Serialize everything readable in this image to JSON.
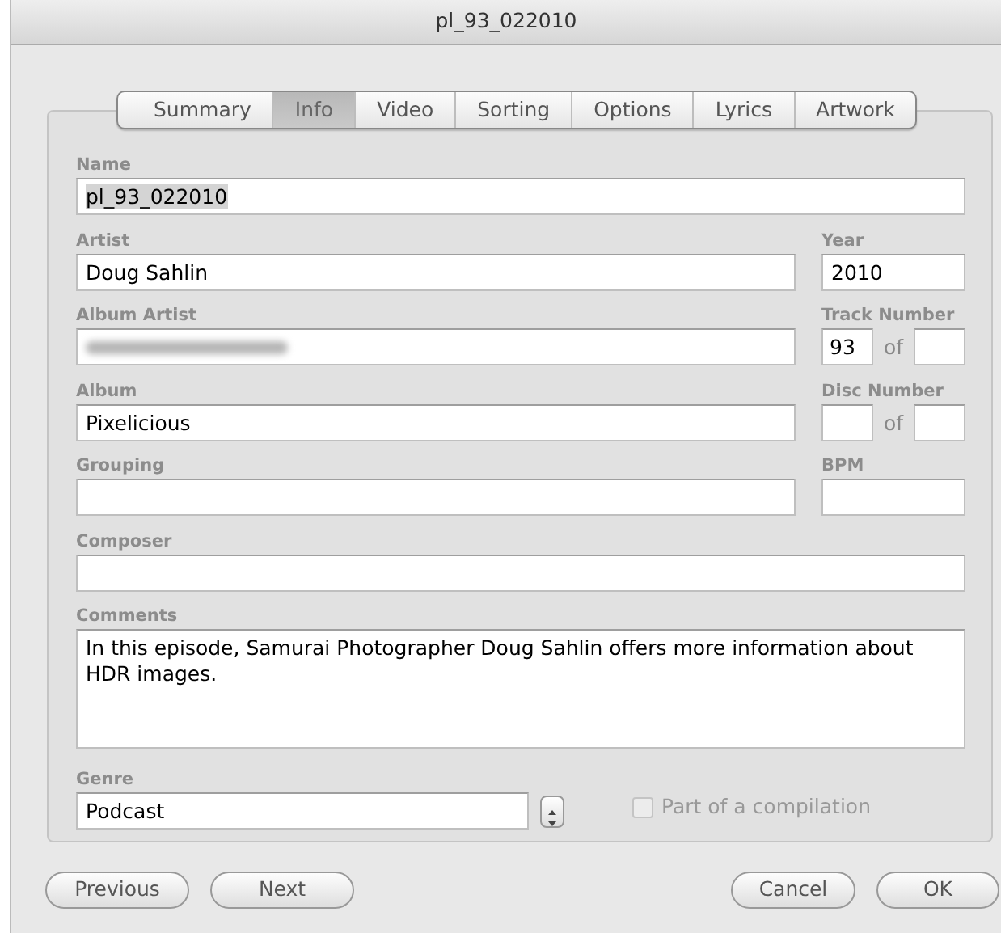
{
  "window": {
    "title": "pl_93_022010"
  },
  "tabs": [
    {
      "label": "Summary",
      "selected": false
    },
    {
      "label": "Info",
      "selected": true
    },
    {
      "label": "Video",
      "selected": false
    },
    {
      "label": "Sorting",
      "selected": false
    },
    {
      "label": "Options",
      "selected": false
    },
    {
      "label": "Lyrics",
      "selected": false
    },
    {
      "label": "Artwork",
      "selected": false
    }
  ],
  "rows": [
    {
      "main": {
        "label": "Name",
        "value": "pl_93_022010",
        "highlighted": true
      }
    },
    {
      "main": {
        "label": "Artist",
        "value": "Doug Sahlin"
      },
      "side": {
        "kind": "single",
        "label": "Year",
        "value": "2010"
      }
    },
    {
      "main": {
        "label": "Album Artist",
        "redacted": true
      },
      "side": {
        "kind": "pair",
        "label": "Track Number",
        "value": "93",
        "separator": "of"
      }
    },
    {
      "main": {
        "label": "Album",
        "value": "Pixelicious"
      },
      "side": {
        "kind": "pair",
        "label": "Disc Number",
        "separator": "of"
      }
    },
    {
      "main": {
        "label": "Grouping"
      },
      "side": {
        "kind": "single",
        "label": "BPM"
      }
    },
    {
      "main": {
        "label": "Composer"
      }
    }
  ],
  "comments": {
    "label": "Comments",
    "value": "In this episode, Samurai Photographer Doug Sahlin offers more information about HDR images."
  },
  "genre": {
    "label": "Genre",
    "value": "Podcast"
  },
  "compilation": {
    "label": "Part of a compilation",
    "checked": false,
    "disabled": true
  },
  "buttons_left": [
    "Previous",
    "Next"
  ],
  "buttons_right": [
    "Cancel",
    "OK"
  ]
}
